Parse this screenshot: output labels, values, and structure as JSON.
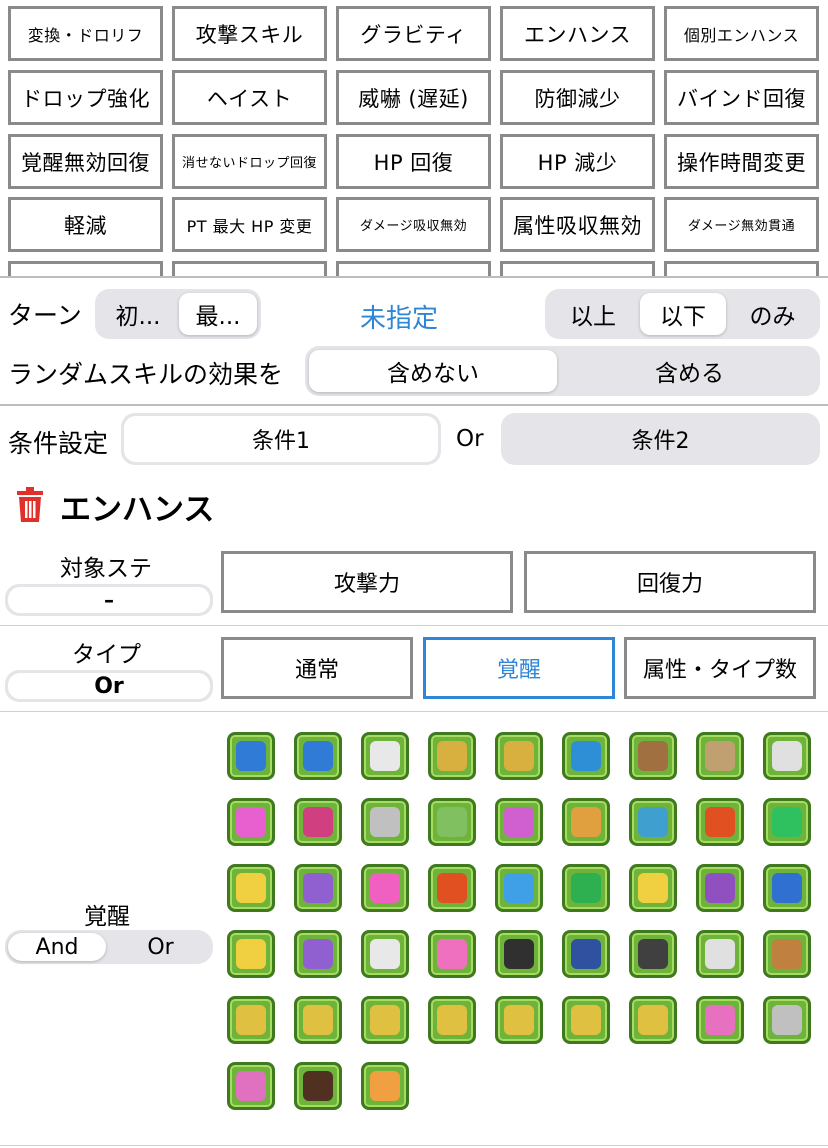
{
  "skill_categories": [
    [
      "変換・ドロリフ",
      "攻撃スキル",
      "グラビティ",
      "エンハンス",
      "個別エンハンス"
    ],
    [
      "ドロップ強化",
      "ヘイスト",
      "威嚇 (遅延)",
      "防御減少",
      "バインド回復"
    ],
    [
      "覚醒無効回復",
      "消せないドロップ回復",
      "HP 回復",
      "HP 減少",
      "操作時間変更"
    ],
    [
      "軽減",
      "PT 最大 HP 変更",
      "ダメージ吸収無効",
      "属性吸収無効",
      "ダメージ無効貫通"
    ]
  ],
  "turn": {
    "label": "ターン",
    "seg": [
      "初...",
      "最..."
    ],
    "value": "未指定",
    "compare": [
      "以上",
      "以下",
      "のみ"
    ]
  },
  "random_skill": {
    "label": "ランダムスキルの効果を",
    "options": [
      "含めない",
      "含める"
    ]
  },
  "conditions": {
    "label": "条件設定",
    "cond1": "条件1",
    "or": "Or",
    "cond2": "条件2"
  },
  "section": {
    "title": "エンハンス"
  },
  "target_stat": {
    "label": "対象ステ",
    "value": "–",
    "options": [
      "攻撃力",
      "回復力"
    ]
  },
  "type": {
    "label": "タイプ",
    "value": "Or",
    "options": [
      "通常",
      "覚醒",
      "属性・タイプ数"
    ]
  },
  "awakening": {
    "label": "覚醒",
    "modes": [
      "And",
      "Or"
    ],
    "icon_colors": [
      [
        "#2f7bd6",
        "#2f7bd6",
        "#e8e8e8",
        "#d8b040",
        "#d8b040",
        "#2f8fd6",
        "#a07040",
        "#c0a070",
        "#e0e0e0"
      ],
      [
        "#e860d0",
        "#d04080",
        "#c0c0c0",
        "#80c060",
        "#d060d0",
        "#e0a040",
        "#3fa0d0",
        "#e05020",
        "#2fc060"
      ],
      [
        "#f0d040",
        "#9060d0",
        "#f060c0",
        "#e05020",
        "#3fa0e8",
        "#2fb050",
        "#f0d040",
        "#9050c0",
        "#3070d0"
      ],
      [
        "#f0d040",
        "#9060d0",
        "#e8e8e8",
        "#f070c0",
        "#303030",
        "#3050a0",
        "#404040",
        "#e0e0e0",
        "#c08040"
      ],
      [
        "#e0c040",
        "#e0c040",
        "#e0c040",
        "#e0c040",
        "#e0c040",
        "#e0c040",
        "#e0c040",
        "#e870c0",
        "#c0c0c0"
      ],
      [
        "#e070c0",
        "#503020",
        "#f0a040"
      ]
    ]
  }
}
